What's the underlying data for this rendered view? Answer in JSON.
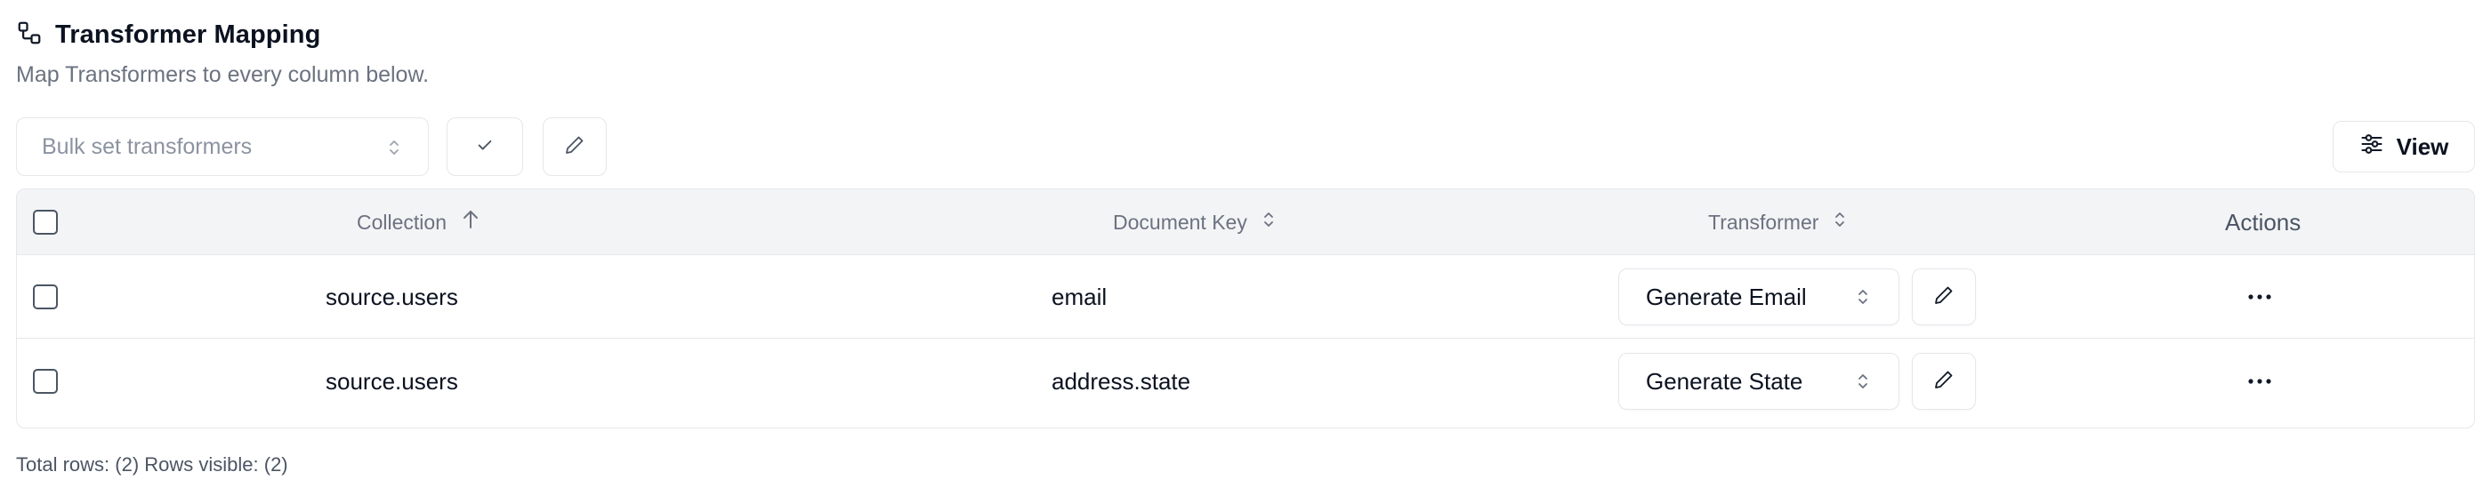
{
  "header": {
    "title": "Transformer Mapping",
    "title_icon": "mapping-icon",
    "subtitle": "Map Transformers to every column below."
  },
  "toolbar": {
    "bulk_placeholder": "Bulk set transformers",
    "apply_icon": "check-icon",
    "edit_icon": "pencil-icon",
    "view_label": "View",
    "view_icon": "sliders-icon"
  },
  "table": {
    "columns": {
      "collection": "Collection",
      "document_key": "Document Key",
      "transformer": "Transformer",
      "actions": "Actions"
    },
    "sort": {
      "collection": "ascending",
      "document_key": "none",
      "transformer": "none"
    },
    "rows": [
      {
        "collection": "source.users",
        "document_key": "email",
        "transformer": "Generate Email"
      },
      {
        "collection": "source.users",
        "document_key": "address.state",
        "transformer": "Generate State"
      }
    ]
  },
  "footer": {
    "status": "Total rows: (2) Rows visible: (2)"
  },
  "colors": {
    "border": "#e5e7eb",
    "header_bg": "#f3f4f6",
    "muted_text": "#6b7280",
    "text": "#0b1220"
  }
}
